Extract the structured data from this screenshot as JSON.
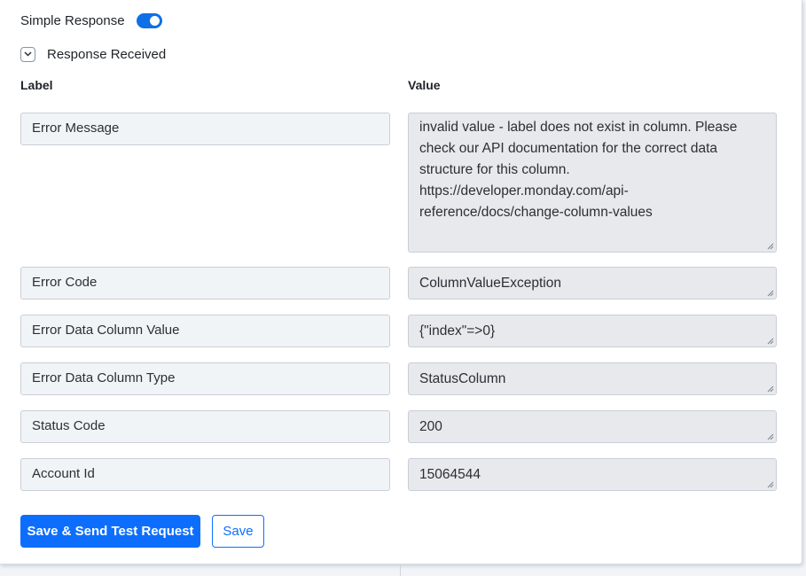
{
  "toggle": {
    "label": "Simple Response",
    "checked": true,
    "color": "#0f6fe6"
  },
  "section": {
    "label": "Response Received",
    "icon": "chevron-down-icon"
  },
  "columns": {
    "label": "Label",
    "value": "Value"
  },
  "rows": [
    {
      "label": "Error Message",
      "value": "invalid value - label does not exist in column. Please check our API documentation for the correct data structure for this column. https://developer.monday.com/api-reference/docs/change-column-values"
    },
    {
      "label": "Error Code",
      "value": "ColumnValueException"
    },
    {
      "label": "Error Data Column Value",
      "value": "{\"index\"=>0}"
    },
    {
      "label": "Error Data Column Type",
      "value": "StatusColumn"
    },
    {
      "label": "Status Code",
      "value": "200"
    },
    {
      "label": "Account Id",
      "value": "15064544"
    }
  ],
  "buttons": {
    "primary": "Save & Send Test Request",
    "secondary": "Save",
    "accent": "#0d6efd"
  }
}
